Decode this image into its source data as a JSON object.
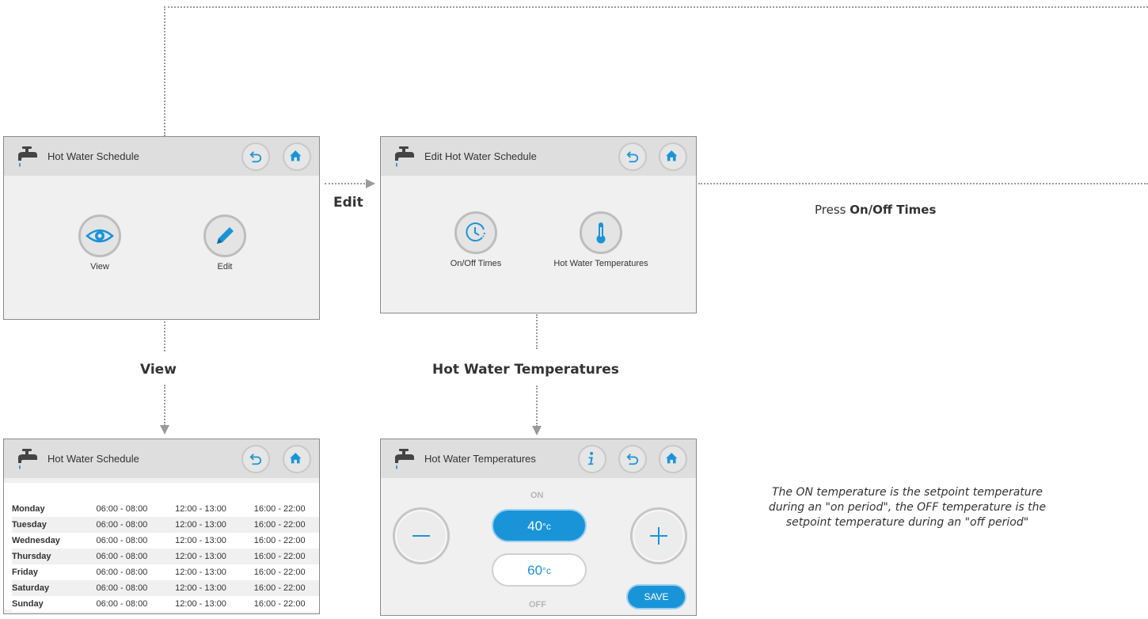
{
  "flow_labels": {
    "edit": "Edit",
    "view": "View",
    "hot_water_temperatures": "Hot Water Temperatures"
  },
  "press_text": {
    "prefix": "Press ",
    "bold": "On/Off Times"
  },
  "note": "The ON temperature is the setpoint temperature during an \"on period\", the OFF temperature is the setpoint temperature during an \"off period\"",
  "screen_hw_schedule": {
    "title": "Hot Water Schedule",
    "view_label": "View",
    "edit_label": "Edit"
  },
  "screen_edit_schedule": {
    "title": "Edit Hot Water Schedule",
    "onoff_label": "On/Off Times",
    "temps_label": "Hot Water Temperatures"
  },
  "screen_view_schedule": {
    "title": "Hot Water Schedule",
    "rows": [
      {
        "day": "Monday",
        "p1": "06:00 - 08:00",
        "p2": "12:00 - 13:00",
        "p3": "16:00 - 22:00"
      },
      {
        "day": "Tuesday",
        "p1": "06:00 - 08:00",
        "p2": "12:00 - 13:00",
        "p3": "16:00 - 22:00"
      },
      {
        "day": "Wednesday",
        "p1": "06:00 - 08:00",
        "p2": "12:00 - 13:00",
        "p3": "16:00 - 22:00"
      },
      {
        "day": "Thursday",
        "p1": "06:00 - 08:00",
        "p2": "12:00 - 13:00",
        "p3": "16:00 - 22:00"
      },
      {
        "day": "Friday",
        "p1": "06:00 - 08:00",
        "p2": "12:00 - 13:00",
        "p3": "16:00 - 22:00"
      },
      {
        "day": "Saturday",
        "p1": "06:00 - 08:00",
        "p2": "12:00 - 13:00",
        "p3": "16:00 - 22:00"
      },
      {
        "day": "Sunday",
        "p1": "06:00 - 08:00",
        "p2": "12:00 - 13:00",
        "p3": "16:00 - 22:00"
      }
    ]
  },
  "screen_temperatures": {
    "title": "Hot Water Temperatures",
    "on_label": "ON",
    "off_label": "OFF",
    "on_value": "40",
    "off_value": "60",
    "unit": "°c",
    "save_label": "SAVE"
  },
  "colors": {
    "accent": "#1a94d8",
    "header": "#dedede",
    "panel": "#f0f0f0",
    "connector": "#9a9a9a"
  }
}
